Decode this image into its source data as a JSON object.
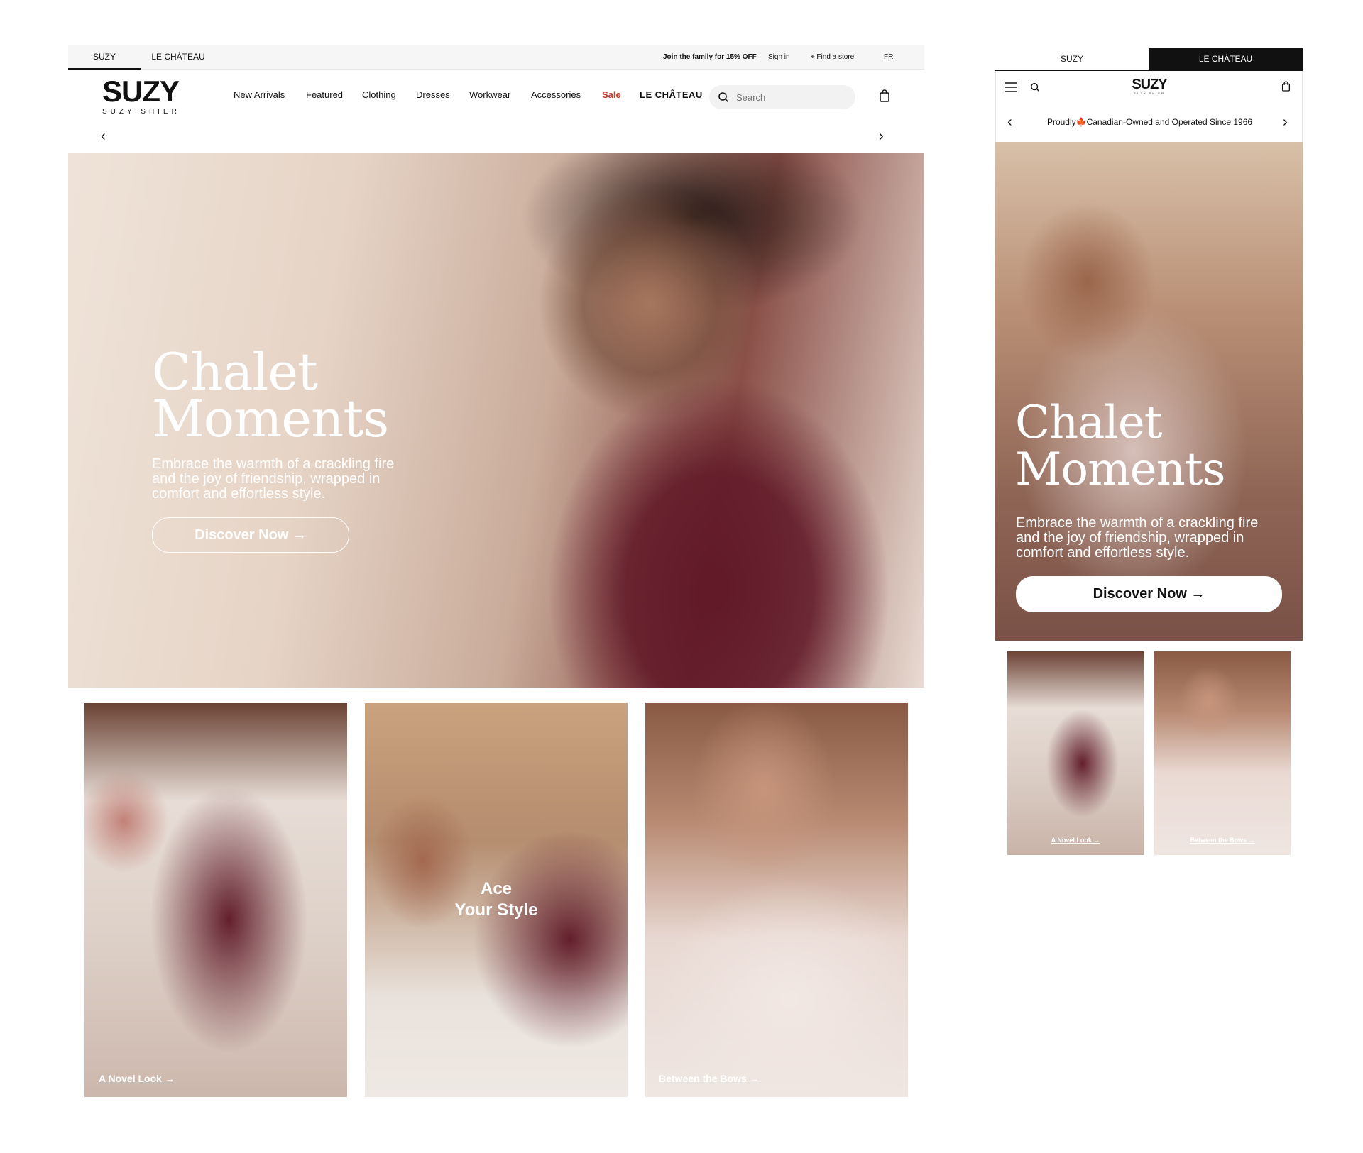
{
  "desktop": {
    "brand_tabs": [
      "SUZY",
      "LE CHÂTEAU"
    ],
    "utility": {
      "promo": "Join the family for 15% OFF",
      "sign_in": "Sign in",
      "find_store": "Find a store",
      "language": "FR"
    },
    "logo": {
      "main": "SUZY",
      "sub": "SUZY SHIER"
    },
    "nav": [
      "New Arrivals",
      "Featured",
      "Clothing",
      "Dresses",
      "Workwear",
      "Accessories",
      "Sale",
      "LE CHÂTEAU"
    ],
    "search": {
      "placeholder": "Search"
    },
    "hero": {
      "title_line1": "Chalet",
      "title_line2": "Moments",
      "subtitle": "Embrace the warmth of a crackling fire and the joy of friendship, wrapped in comfort and effortless style.",
      "cta": "Discover Now →"
    },
    "cards": [
      {
        "link": "A Novel Look →"
      },
      {
        "overlay_line1": "Ace",
        "overlay_line2": "Your Style"
      },
      {
        "link": "Between the Bows →"
      }
    ]
  },
  "mobile": {
    "brand_tabs": [
      "SUZY",
      "LE CHÂTEAU"
    ],
    "logo": {
      "main": "SUZY",
      "sub": "SUZY SHIER"
    },
    "promo": "Proudly🍁Canadian-Owned and Operated Since 1966",
    "hero": {
      "title_line1": "Chalet",
      "title_line2": "Moments",
      "subtitle": "Embrace the warmth of a crackling fire and the joy of friendship, wrapped in comfort and effortless style.",
      "cta": "Discover Now →"
    },
    "cards": [
      {
        "link": "A Novel Look →"
      },
      {
        "link": "Between the Bows →"
      }
    ]
  },
  "colors": {
    "sale": "#c0392b",
    "active_tab_bg": "#111111",
    "burgundy": "#5c1624"
  },
  "icons": [
    "chevron-left-icon",
    "chevron-right-icon",
    "search-icon",
    "bag-icon",
    "menu-icon",
    "pin-icon"
  ]
}
